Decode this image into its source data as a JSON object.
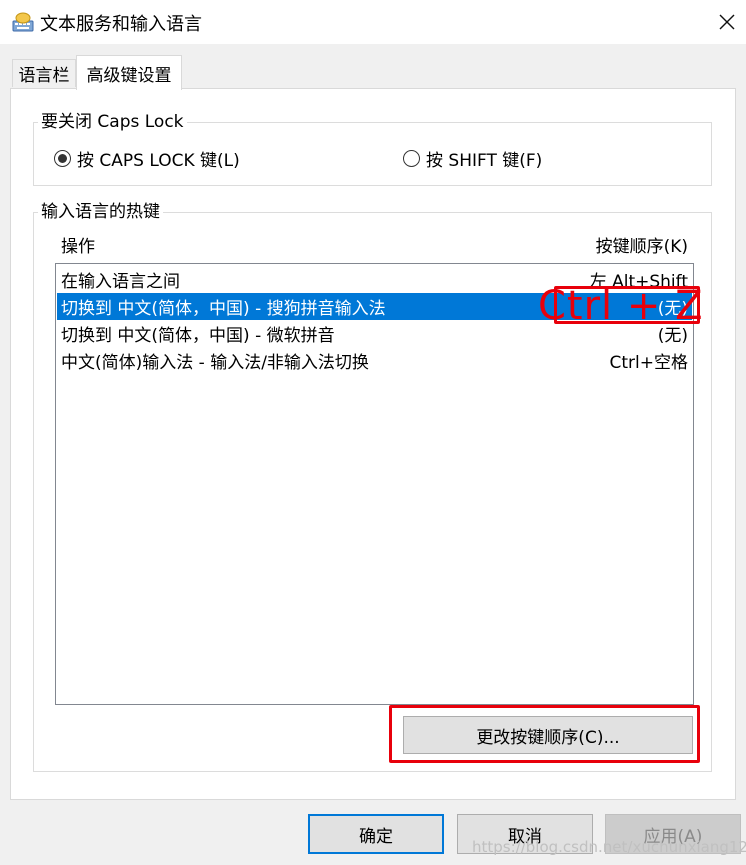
{
  "window": {
    "title": "文本服务和输入语言",
    "app_icon": "keyboard-icon",
    "close_icon": "close-icon"
  },
  "tabs": [
    {
      "label": "语言栏",
      "active": false
    },
    {
      "label": "高级键设置",
      "active": true
    }
  ],
  "caps_group": {
    "title": "要关闭 Caps Lock",
    "options": [
      {
        "label": "按 CAPS LOCK 键(L)",
        "selected": true
      },
      {
        "label": "按 SHIFT 键(F)",
        "selected": false
      }
    ]
  },
  "hotkeys_group": {
    "title": "输入语言的热键",
    "col_action": "操作",
    "col_sequence": "按键顺序(K)",
    "rows": [
      {
        "action": "在输入语言之间",
        "sequence": "左 Alt+Shift",
        "selected": false
      },
      {
        "action": "切换到 中文(简体，中国) - 搜狗拼音输入法",
        "sequence": "(无)",
        "selected": true
      },
      {
        "action": "切换到 中文(简体，中国) - 微软拼音",
        "sequence": "(无)",
        "selected": false
      },
      {
        "action": "中文(简体)输入法 - 输入法/非输入法切换",
        "sequence": "Ctrl+空格",
        "selected": false
      }
    ],
    "change_button": "更改按键顺序(C)..."
  },
  "annotation": {
    "text": "Ctrl + Z",
    "color": "#e8000b"
  },
  "footer": {
    "ok": "确定",
    "cancel": "取消",
    "apply": "应用(A)"
  },
  "watermark": "https://blog.csdn.net/xuchunxiang123"
}
